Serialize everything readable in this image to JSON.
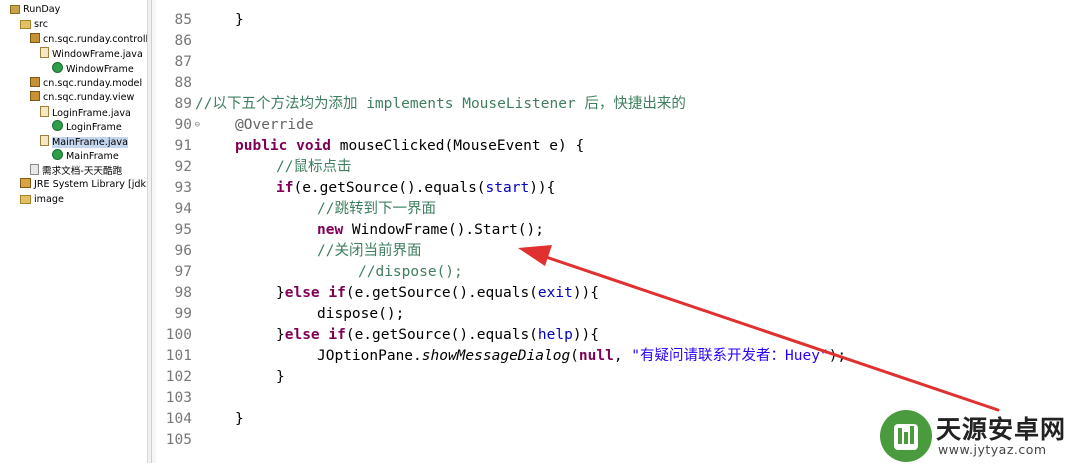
{
  "explorer": {
    "items": [
      {
        "label": "RunDay",
        "icon": "project-icon"
      },
      {
        "label": "src",
        "icon": "source-folder-icon"
      },
      {
        "label": "cn.sqc.runday.controll",
        "icon": "package-icon"
      },
      {
        "label": "WindowFrame.java",
        "icon": "java-file-icon"
      },
      {
        "label": "WindowFrame",
        "icon": "class-icon"
      },
      {
        "label": "cn.sqc.runday.model",
        "icon": "package-icon"
      },
      {
        "label": "cn.sqc.runday.view",
        "icon": "package-icon"
      },
      {
        "label": "LoginFrame.java",
        "icon": "java-file-icon"
      },
      {
        "label": "LoginFrame",
        "icon": "class-icon"
      },
      {
        "label": "MainFrame.java",
        "icon": "java-file-icon"
      },
      {
        "label": "MainFrame",
        "icon": "class-icon"
      },
      {
        "label": "需求文档-天天酷跑",
        "icon": "text-file-icon"
      },
      {
        "label": "JRE System Library [jdk1",
        "icon": "library-icon"
      },
      {
        "label": "image",
        "icon": "folder-icon"
      }
    ]
  },
  "editor": {
    "line_numbers": [
      "85",
      "86",
      "87",
      "88",
      "89",
      "90",
      "91",
      "92",
      "93",
      "94",
      "95",
      "96",
      "97",
      "98",
      "99",
      "100",
      "101",
      "102",
      "103",
      "104",
      "105"
    ],
    "fold_marker": "⊖",
    "lines": {
      "l85": "}",
      "l89": "//以下五个方法均为添加 implements MouseListener 后，快捷出来的",
      "l90": "@Override",
      "l91_kw": "public void",
      "l91_rest": " mouseClicked(MouseEvent e) {",
      "l92": "//鼠标点击",
      "l93_kw": "if",
      "l93_a": "(e.getSource().equals(",
      "l93_f": "start",
      "l93_b": ")){",
      "l94": "//跳转到下一界面",
      "l95_kw": "new",
      "l95_rest": " WindowFrame().Start();",
      "l96": "//关闭当前界面",
      "l97": "//dispose();",
      "l98_a": "}",
      "l98_kw": "else if",
      "l98_b": "(e.getSource().equals(",
      "l98_f": "exit",
      "l98_c": ")){",
      "l99": "dispose();",
      "l100_a": "}",
      "l100_kw": "else if",
      "l100_b": "(e.getSource().equals(",
      "l100_f": "help",
      "l100_c": ")){",
      "l101_a": "JOptionPane.",
      "l101_m": "showMessageDialog",
      "l101_b": "(",
      "l101_kw": "null",
      "l101_c": ", ",
      "l101_s": "\"有疑问请联系开发者：Huey\"",
      "l101_d": ");",
      "l102": "}",
      "l104": "}"
    }
  },
  "watermark": {
    "title": "天源安卓网",
    "url": "www.jytyaz.com"
  },
  "colors": {
    "keyword": "#7f0055",
    "comment": "#3f7f5f",
    "string": "#2a00ff",
    "field": "#0000c0",
    "annotation_arrow": "#e03030",
    "logo_green": "#4a9b3e"
  }
}
